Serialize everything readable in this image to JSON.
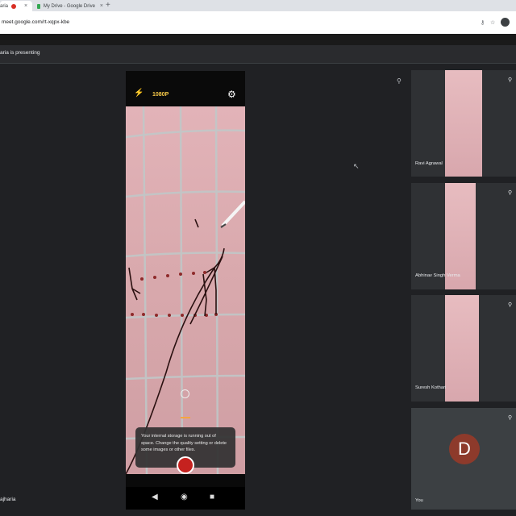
{
  "browser": {
    "tabs": [
      {
        "label": "aria",
        "active": true
      },
      {
        "label": "My Drive - Google Drive",
        "active": false
      }
    ],
    "new_tab": "+",
    "close": "×",
    "url": "meet.google.com/rt-xqpx-kbe"
  },
  "meet": {
    "presenting_label": "aria is presenting",
    "presenter_name": "ajharia"
  },
  "phone": {
    "resolution": "1080P",
    "toast_text": "Your internal storage is running out of space. Change the quality setting or delete some images or other files."
  },
  "participants": [
    {
      "name": "Ravi Agrawal"
    },
    {
      "name": "Abhinav Singh Verma"
    },
    {
      "name": "Suresh Kothari"
    },
    {
      "name": "You",
      "avatar_letter": "D"
    }
  ],
  "colors": {
    "meet_bg": "#202124",
    "tile_bg": "#3c4043",
    "accent_yellow": "#f7c948",
    "record_red": "#c5221f",
    "avatar_bg": "#8d3a2b"
  }
}
